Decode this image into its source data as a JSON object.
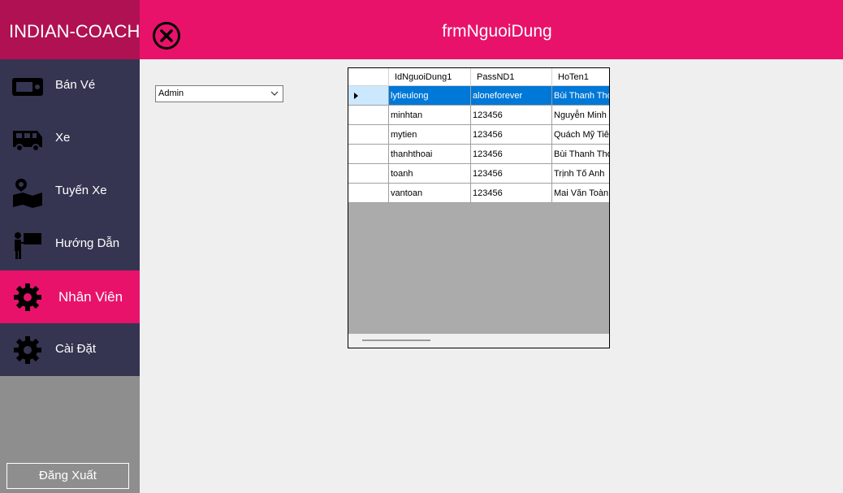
{
  "brand": "INDIAN-COACH",
  "menu": [
    {
      "label": "Bán Vé",
      "icon": "ticket-icon"
    },
    {
      "label": "Xe",
      "icon": "bus-icon"
    },
    {
      "label": "Tuyến Xe",
      "icon": "map-route-icon"
    },
    {
      "label": "Hướng Dẫn",
      "icon": "presenter-icon"
    },
    {
      "label": "Nhân Viên",
      "icon": "gear-icon",
      "active": true
    },
    {
      "label": "Cài Đặt",
      "icon": "gear-icon"
    }
  ],
  "logout_label": "Đăng Xuất",
  "header": {
    "title": "frmNguoiDung",
    "close_icon": "close-circle-icon"
  },
  "role_combo": {
    "value": "Admin"
  },
  "grid": {
    "columns": [
      "IdNguoiDung1",
      "PassND1",
      "HoTen1"
    ],
    "rows": [
      [
        "lytieulong",
        "aloneforever",
        "Bùi Thanh Thọ"
      ],
      [
        "minhtan",
        "123456",
        "Nguyễn Minh Tân"
      ],
      [
        "mytien",
        "123456",
        "Quách Mỹ Tiên"
      ],
      [
        "thanhthoai",
        "123456",
        "Bùi Thanh Thoại"
      ],
      [
        "toanh",
        "123456",
        "Trịnh Tố Anh"
      ],
      [
        "vantoan",
        "123456",
        "Mai Văn Toàn"
      ]
    ],
    "selected_row": 0
  },
  "colors": {
    "accent": "#e8126b",
    "brand_bg": "#b01153",
    "menu_bg": "#353552",
    "selection": "#0078d7"
  }
}
